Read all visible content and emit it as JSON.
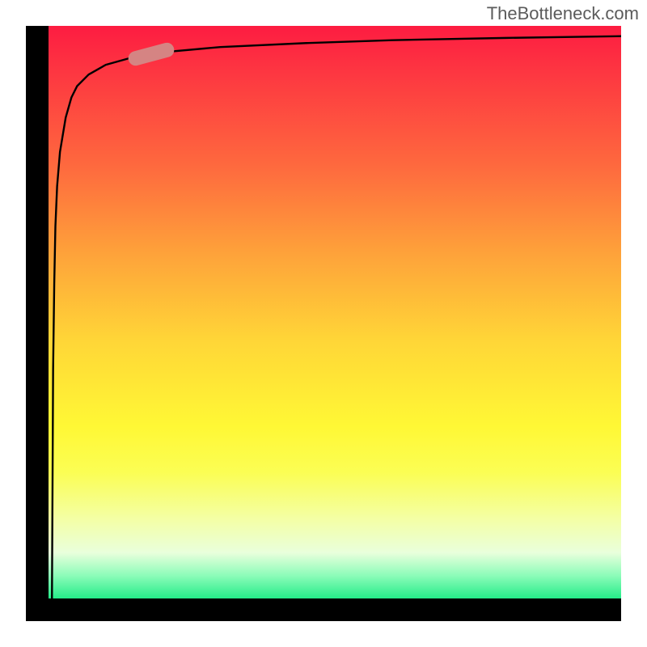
{
  "attribution": "TheBottleneck.com",
  "chart_data": {
    "type": "line",
    "title": "",
    "xlabel": "",
    "ylabel": "",
    "xlim": [
      0,
      100
    ],
    "ylim": [
      0,
      100
    ],
    "series": [
      {
        "name": "curve",
        "x": [
          0.6,
          0.7,
          0.8,
          1.0,
          1.2,
          1.5,
          2.0,
          3.0,
          4.0,
          5.0,
          7.0,
          10.0,
          15.0,
          20.0,
          30.0,
          45.0,
          60.0,
          80.0,
          100.0
        ],
        "values": [
          0,
          20,
          40,
          55,
          65,
          72,
          78,
          84,
          87.5,
          89.5,
          91.5,
          93.2,
          94.6,
          95.4,
          96.3,
          97.0,
          97.5,
          97.9,
          98.2
        ]
      }
    ],
    "marker": {
      "x": 18,
      "y": 95,
      "angle_deg": -15
    },
    "background_gradient": {
      "top": "#fd1c41",
      "upper_mid": "#fe8a3c",
      "mid": "#ffe536",
      "lower_mid": "#f5ff97",
      "bottom": "#25ec89"
    }
  }
}
